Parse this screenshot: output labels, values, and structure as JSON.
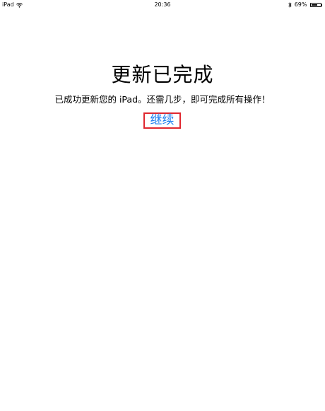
{
  "status_bar": {
    "device": "iPad",
    "time": "20:36",
    "battery_text": "69%",
    "battery_level": 0.69,
    "icons": [
      "wifi-icon",
      "bluetooth-icon",
      "battery-icon"
    ]
  },
  "main": {
    "title": "更新已完成",
    "subtitle": "已成功更新您的 iPad。还需几步，即可完成所有操作！",
    "continue_label": "继续"
  },
  "colors": {
    "link": "#1a7ef0",
    "highlight_border": "#e0272f",
    "background": "#ffffff"
  }
}
